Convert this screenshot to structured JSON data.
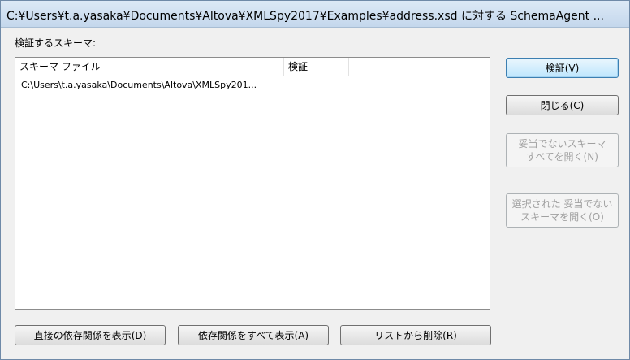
{
  "window": {
    "title": "C:¥Users¥t.a.yasaka¥Documents¥Altova¥XMLSpy2017¥Examples¥address.xsd に対する SchemaAgent ..."
  },
  "dialog": {
    "schemas_label": "検証するスキーマ:",
    "list": {
      "columns": [
        "スキーマ ファイル",
        "検証"
      ],
      "rows": [
        {
          "file": "C:\\Users\\t.a.yasaka\\Documents\\Altova\\XMLSpy201...",
          "verify": ""
        }
      ]
    },
    "buttons": {
      "verify": "検証(V)",
      "close": "閉じる(C)",
      "open_all_invalid_line1": "妥当でないスキーマ",
      "open_all_invalid_line2": "すべてを開く(N)",
      "open_selected_invalid_line1": "選択された 妥当でない",
      "open_selected_invalid_line2": "スキーマを開く(O)",
      "show_direct_deps": "直接の依存関係を表示(D)",
      "show_all_deps": "依存関係をすべて表示(A)",
      "remove_from_list": "リストから削除(R)"
    }
  }
}
